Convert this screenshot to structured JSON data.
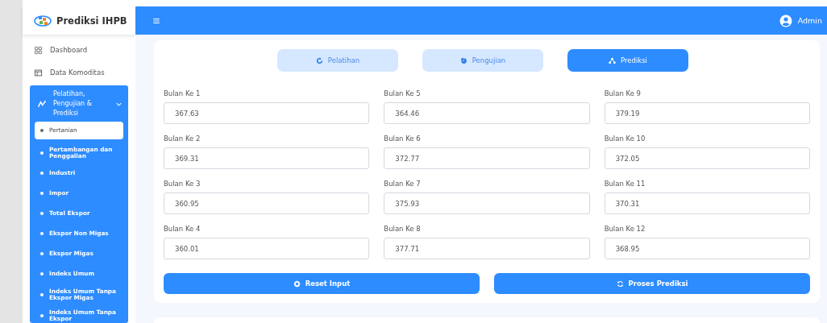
{
  "brand": {
    "title": "Prediksi IHPB"
  },
  "topbar": {
    "user": "Admin"
  },
  "sidebar": {
    "items": [
      {
        "label": "Dashboard",
        "kind": "link"
      },
      {
        "label": "Data Komoditas",
        "kind": "link"
      },
      {
        "label": "Pelatihan, Pengujian & Prediksi",
        "kind": "group",
        "expanded": true,
        "children": [
          {
            "label": "Pertanian",
            "selected": true
          },
          {
            "label": "Pertambangan dan Penggalian",
            "selected": false
          },
          {
            "label": "Industri",
            "selected": false
          },
          {
            "label": "Impor",
            "selected": false
          },
          {
            "label": "Total Ekspor",
            "selected": false
          },
          {
            "label": "Ekspor Non Migas",
            "selected": false
          },
          {
            "label": "Ekspor Migas",
            "selected": false
          },
          {
            "label": "Indeks Umum",
            "selected": false
          },
          {
            "label": "Indeks Umum Tanpa Ekspor Migas",
            "selected": false
          },
          {
            "label": "Indeks Umum Tanpa Ekspor",
            "selected": false
          }
        ]
      }
    ]
  },
  "tabs": [
    {
      "label": "Pelatihan",
      "selected": false
    },
    {
      "label": "Pengujian",
      "selected": false
    },
    {
      "label": "Prediksi",
      "selected": true
    }
  ],
  "fields": [
    {
      "label": "Bulan Ke 1",
      "value": "367.63"
    },
    {
      "label": "Bulan Ke 2",
      "value": "369.31"
    },
    {
      "label": "Bulan Ke 3",
      "value": "360.95"
    },
    {
      "label": "Bulan Ke 4",
      "value": "360.01"
    },
    {
      "label": "Bulan Ke 5",
      "value": "364.46"
    },
    {
      "label": "Bulan Ke 6",
      "value": "372.77"
    },
    {
      "label": "Bulan Ke 7",
      "value": "375.93"
    },
    {
      "label": "Bulan Ke 8",
      "value": "377.71"
    },
    {
      "label": "Bulan Ke 9",
      "value": "379.19"
    },
    {
      "label": "Bulan Ke 10",
      "value": "372.05"
    },
    {
      "label": "Bulan Ke 11",
      "value": "370.31"
    },
    {
      "label": "Bulan Ke 12",
      "value": "368.95"
    }
  ],
  "buttons": [
    {
      "label": "Reset Input"
    },
    {
      "label": "Proses Prediksi"
    }
  ]
}
